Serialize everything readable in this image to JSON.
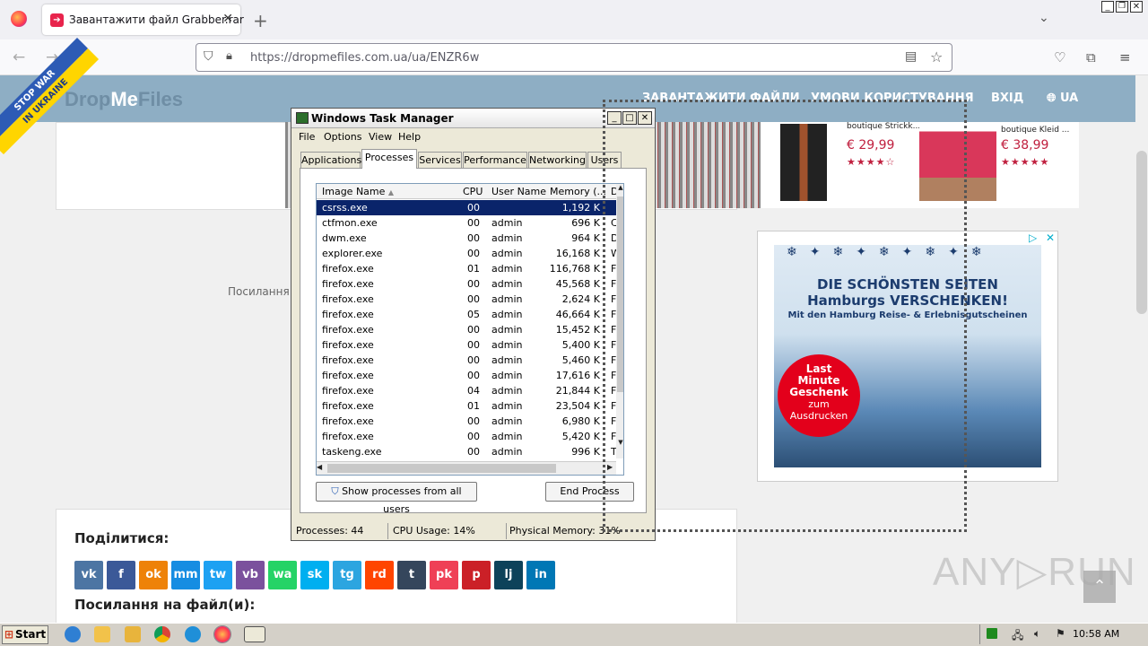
{
  "browser": {
    "tab_title": "Завантажити файл Grabber.rar",
    "url": "https://dropmefiles.com.ua/ua/ENZR6w"
  },
  "site": {
    "logo_a": "Drop",
    "logo_b": "Me",
    "logo_c": "Files",
    "stop_top": "STOP WAR",
    "stop_bottom": "IN UKRAINE",
    "menu": [
      "ЗАВАНТАЖИТИ ФАЙЛИ",
      "УМОВИ КОРИСТУВАННЯ",
      "ВХІД",
      "UA"
    ],
    "products": [
      {
        "title": "boutique Strickk...",
        "price": "€ 29,99",
        "stars": "★★★★☆"
      },
      {
        "title": "boutique Kleid ...",
        "price": "€ 38,99",
        "stars": "★★★★★"
      }
    ],
    "link_text": "Посилання ,",
    "ad": {
      "line1": "DIE SCHÖNSTEN SEITEN",
      "line2": "Hamburgs VERSCHENKEN!",
      "line3": "Mit den Hamburg Reise- & Erlebnisgutscheinen",
      "badge1": "Last",
      "badge2": "Minute",
      "badge3": "Geschenk",
      "badge4": "zum",
      "badge5": "Ausdrucken"
    },
    "share_heading": "Поділитися:",
    "files_heading": "Посилання на файл(и):",
    "social": [
      "vk",
      "f",
      "ok",
      "mm",
      "tw",
      "vb",
      "wa",
      "sk",
      "tg",
      "rd",
      "t",
      "pk",
      "p",
      "lj",
      "in"
    ],
    "social_colors": [
      "#4c75a3",
      "#3b5998",
      "#ee8208",
      "#168de2",
      "#1da1f2",
      "#7b519d",
      "#25d366",
      "#00aff0",
      "#2ca5e0",
      "#ff4500",
      "#35465c",
      "#ef4056",
      "#cb2027",
      "#0d425a",
      "#0077b5"
    ],
    "watermark": "ANY▷RUN"
  },
  "taskmanager": {
    "title": "Windows Task Manager",
    "menu": [
      "File",
      "Options",
      "View",
      "Help"
    ],
    "tabs": [
      "Applications",
      "Processes",
      "Services",
      "Performance",
      "Networking",
      "Users"
    ],
    "columns": [
      "Image Name",
      "CPU",
      "User Name",
      "Memory (...",
      "D"
    ],
    "rows": [
      [
        "csrss.exe",
        "00",
        "",
        "1,192 K",
        ""
      ],
      [
        "ctfmon.exe",
        "00",
        "admin",
        "696 K",
        "C"
      ],
      [
        "dwm.exe",
        "00",
        "admin",
        "964 K",
        "D"
      ],
      [
        "explorer.exe",
        "00",
        "admin",
        "16,168 K",
        "W"
      ],
      [
        "firefox.exe",
        "01",
        "admin",
        "116,768 K",
        "Fi"
      ],
      [
        "firefox.exe",
        "00",
        "admin",
        "45,568 K",
        "Fi"
      ],
      [
        "firefox.exe",
        "00",
        "admin",
        "2,624 K",
        "Fi"
      ],
      [
        "firefox.exe",
        "05",
        "admin",
        "46,664 K",
        "Fi"
      ],
      [
        "firefox.exe",
        "00",
        "admin",
        "15,452 K",
        "Fi"
      ],
      [
        "firefox.exe",
        "00",
        "admin",
        "5,400 K",
        "Fi"
      ],
      [
        "firefox.exe",
        "00",
        "admin",
        "5,460 K",
        "Fi"
      ],
      [
        "firefox.exe",
        "00",
        "admin",
        "17,616 K",
        "Fi"
      ],
      [
        "firefox.exe",
        "04",
        "admin",
        "21,844 K",
        "Fi"
      ],
      [
        "firefox.exe",
        "01",
        "admin",
        "23,504 K",
        "Fi"
      ],
      [
        "firefox.exe",
        "00",
        "admin",
        "6,980 K",
        "Fi"
      ],
      [
        "firefox.exe",
        "00",
        "admin",
        "5,420 K",
        "Fi"
      ],
      [
        "taskeng.exe",
        "00",
        "admin",
        "996 K",
        "T"
      ]
    ],
    "show_all_label": "Show processes from all users",
    "end_process_label": "End Process",
    "status_processes": "Processes: 44",
    "status_cpu": "CPU Usage: 14%",
    "status_memory": "Physical Memory: 31%"
  },
  "taskbar": {
    "start_label": "Start",
    "clock": "10:58 AM"
  }
}
